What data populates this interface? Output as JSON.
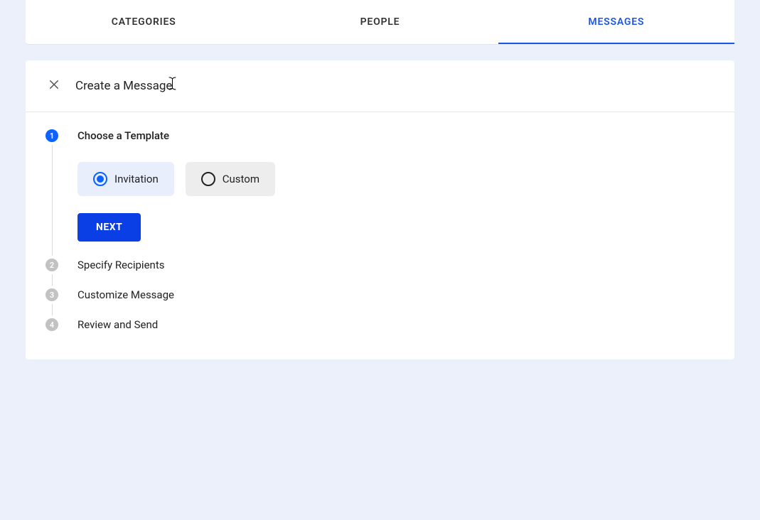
{
  "colors": {
    "accent": "#0b62ff",
    "primaryButton": "#0b3fe6",
    "pageBg": "#ebf0fb",
    "selectedChipBg": "#e9eefc",
    "chipBg": "#ededed",
    "inactiveStep": "#c2c2c2"
  },
  "tabs": [
    {
      "label": "CATEGORIES",
      "active": false
    },
    {
      "label": "PEOPLE",
      "active": false
    },
    {
      "label": "MESSAGES",
      "active": true
    }
  ],
  "dialog": {
    "title": "Create a Message"
  },
  "stepper": {
    "activeIndex": 0,
    "steps": [
      {
        "number": "1",
        "title": "Choose a Template"
      },
      {
        "number": "2",
        "title": "Specify Recipients"
      },
      {
        "number": "3",
        "title": "Customize Message"
      },
      {
        "number": "4",
        "title": "Review and Send"
      }
    ]
  },
  "templateOptions": {
    "selected": "invitation",
    "items": [
      {
        "key": "invitation",
        "label": "Invitation"
      },
      {
        "key": "custom",
        "label": "Custom"
      }
    ]
  },
  "buttons": {
    "next": "NEXT"
  }
}
